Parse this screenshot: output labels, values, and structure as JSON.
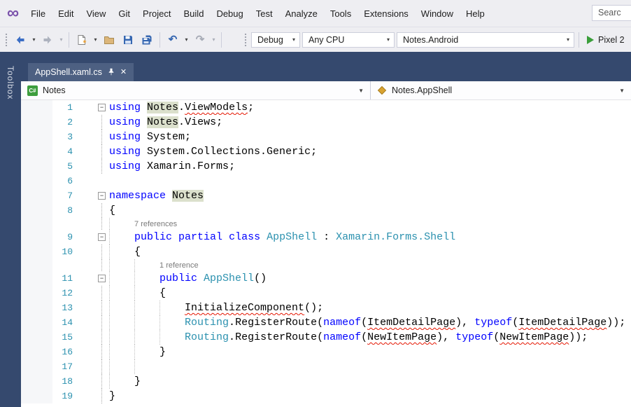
{
  "palette": {
    "keyword": "#0000FF",
    "type_name": "#2B91AF",
    "line_number": "#2B91AF",
    "highlight_bg": "#DBE0CC",
    "error_squiggle": "#E51400",
    "title_band": "#35496E",
    "active_tab": "#4D6082",
    "run_green": "#3A9E3A"
  },
  "menu": {
    "items": [
      "File",
      "Edit",
      "View",
      "Git",
      "Project",
      "Build",
      "Debug",
      "Test",
      "Analyze",
      "Tools",
      "Extensions",
      "Window",
      "Help"
    ],
    "search_text": "Searc"
  },
  "toolbar": {
    "debug_config": "Debug",
    "platform": "Any CPU",
    "startup_project": "Notes.Android",
    "run_target": "Pixel 2"
  },
  "sidebar": {
    "toolbox_label": "Toolbox"
  },
  "tab_bar": {
    "tabs": [
      {
        "label": "AppShell.xaml.cs",
        "pinned": true,
        "active": true
      }
    ]
  },
  "navbar": {
    "left_dropdown": "Notes",
    "right_dropdown": "Notes.AppShell"
  },
  "editor": {
    "lines": [
      {
        "n": "1",
        "fold": true,
        "tokens": [
          [
            "using",
            "kw"
          ],
          [
            " "
          ],
          [
            "Notes",
            "hl"
          ],
          [
            "."
          ],
          [
            "ViewModels",
            "sq"
          ],
          [
            ";"
          ]
        ]
      },
      {
        "n": "2",
        "foldline": true,
        "tokens": [
          [
            "using",
            "kw"
          ],
          [
            " "
          ],
          [
            "Notes",
            "hl"
          ],
          [
            "."
          ],
          [
            "Views"
          ],
          [
            ";"
          ]
        ]
      },
      {
        "n": "3",
        "foldline": true,
        "tokens": [
          [
            "using",
            "kw"
          ],
          [
            " "
          ],
          [
            "System"
          ],
          [
            ";"
          ]
        ]
      },
      {
        "n": "4",
        "foldline": true,
        "tokens": [
          [
            "using",
            "kw"
          ],
          [
            " "
          ],
          [
            "System.Collections.Generic"
          ],
          [
            ";"
          ]
        ]
      },
      {
        "n": "5",
        "foldline": true,
        "tokens": [
          [
            "using",
            "kw"
          ],
          [
            " "
          ],
          [
            "Xamarin.Forms"
          ],
          [
            ";"
          ]
        ]
      },
      {
        "n": "6",
        "tokens": []
      },
      {
        "n": "7",
        "fold": true,
        "tokens": [
          [
            "namespace",
            "kw"
          ],
          [
            " "
          ],
          [
            "Notes",
            "hl"
          ]
        ]
      },
      {
        "n": "8",
        "foldline": true,
        "tokens": [
          [
            "{"
          ]
        ]
      },
      {
        "lens": "7 references",
        "indent": 4,
        "foldline": true,
        "guides": [
          0
        ]
      },
      {
        "n": "9",
        "fold": true,
        "guides": [
          0
        ],
        "tokens": [
          [
            "    "
          ],
          [
            "public",
            "kw"
          ],
          [
            " "
          ],
          [
            "partial",
            "kw"
          ],
          [
            " "
          ],
          [
            "class",
            "kw"
          ],
          [
            " "
          ],
          [
            "AppShell",
            "ty"
          ],
          [
            " : "
          ],
          [
            "Xamarin.Forms.Shell",
            "ty"
          ]
        ]
      },
      {
        "n": "10",
        "foldline": true,
        "guides": [
          0
        ],
        "tokens": [
          [
            "    {"
          ]
        ]
      },
      {
        "lens": "1 reference",
        "indent": 8,
        "foldline": true,
        "guides": [
          0,
          4
        ]
      },
      {
        "n": "11",
        "fold": true,
        "guides": [
          0,
          4
        ],
        "tokens": [
          [
            "        "
          ],
          [
            "public",
            "kw"
          ],
          [
            " "
          ],
          [
            "AppShell",
            "ty"
          ],
          [
            "()"
          ]
        ]
      },
      {
        "n": "12",
        "foldline": true,
        "guides": [
          0,
          4
        ],
        "tokens": [
          [
            "        {"
          ]
        ]
      },
      {
        "n": "13",
        "foldline": true,
        "guides": [
          0,
          4,
          8
        ],
        "tokens": [
          [
            "            "
          ],
          [
            "InitializeComponent",
            "sq"
          ],
          [
            "();"
          ]
        ]
      },
      {
        "n": "14",
        "foldline": true,
        "guides": [
          0,
          4,
          8
        ],
        "tokens": [
          [
            "            "
          ],
          [
            "Routing",
            "ty"
          ],
          [
            "."
          ],
          [
            "RegisterRoute"
          ],
          [
            "("
          ],
          [
            "nameof",
            "kw"
          ],
          [
            "("
          ],
          [
            "ItemDetailPage",
            "sq"
          ],
          [
            "), "
          ],
          [
            "typeof",
            "kw"
          ],
          [
            "("
          ],
          [
            "ItemDetailPage",
            "sq"
          ],
          [
            "));"
          ]
        ]
      },
      {
        "n": "15",
        "foldline": true,
        "guides": [
          0,
          4,
          8
        ],
        "tokens": [
          [
            "            "
          ],
          [
            "Routing",
            "ty"
          ],
          [
            "."
          ],
          [
            "RegisterRoute"
          ],
          [
            "("
          ],
          [
            "nameof",
            "kw"
          ],
          [
            "("
          ],
          [
            "NewItemPage",
            "sq"
          ],
          [
            "), "
          ],
          [
            "typeof",
            "kw"
          ],
          [
            "("
          ],
          [
            "NewItemPage",
            "sq"
          ],
          [
            "));"
          ]
        ]
      },
      {
        "n": "16",
        "foldline": true,
        "guides": [
          0,
          4
        ],
        "tokens": [
          [
            "        }"
          ]
        ]
      },
      {
        "n": "17",
        "foldline": true,
        "guides": [
          0,
          4
        ],
        "tokens": []
      },
      {
        "n": "18",
        "foldline": true,
        "guides": [
          0
        ],
        "tokens": [
          [
            "    }"
          ]
        ]
      },
      {
        "n": "19",
        "foldline": true,
        "tokens": [
          [
            "}"
          ]
        ]
      }
    ]
  }
}
